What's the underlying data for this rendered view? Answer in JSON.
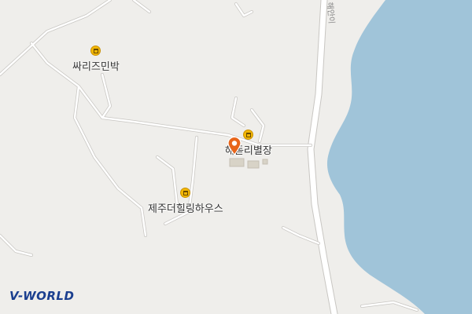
{
  "map": {
    "provider_logo": "V-WORLD",
    "road_label": "해안이",
    "colors": {
      "land": "#efeeeb",
      "water": "#a0c4d9",
      "road": "#ffffff",
      "road_edge": "#c8c6c2",
      "poi": "#f2b705",
      "marker": "#e8651a"
    },
    "pois": [
      {
        "name": "싸리즈민박",
        "icon": "lodging-icon"
      },
      {
        "name": "해돋리별장",
        "icon": "lodging-icon"
      },
      {
        "name": "제주더힐링하우스",
        "icon": "lodging-icon"
      }
    ],
    "marker": {
      "icon": "location-pin-icon"
    }
  }
}
